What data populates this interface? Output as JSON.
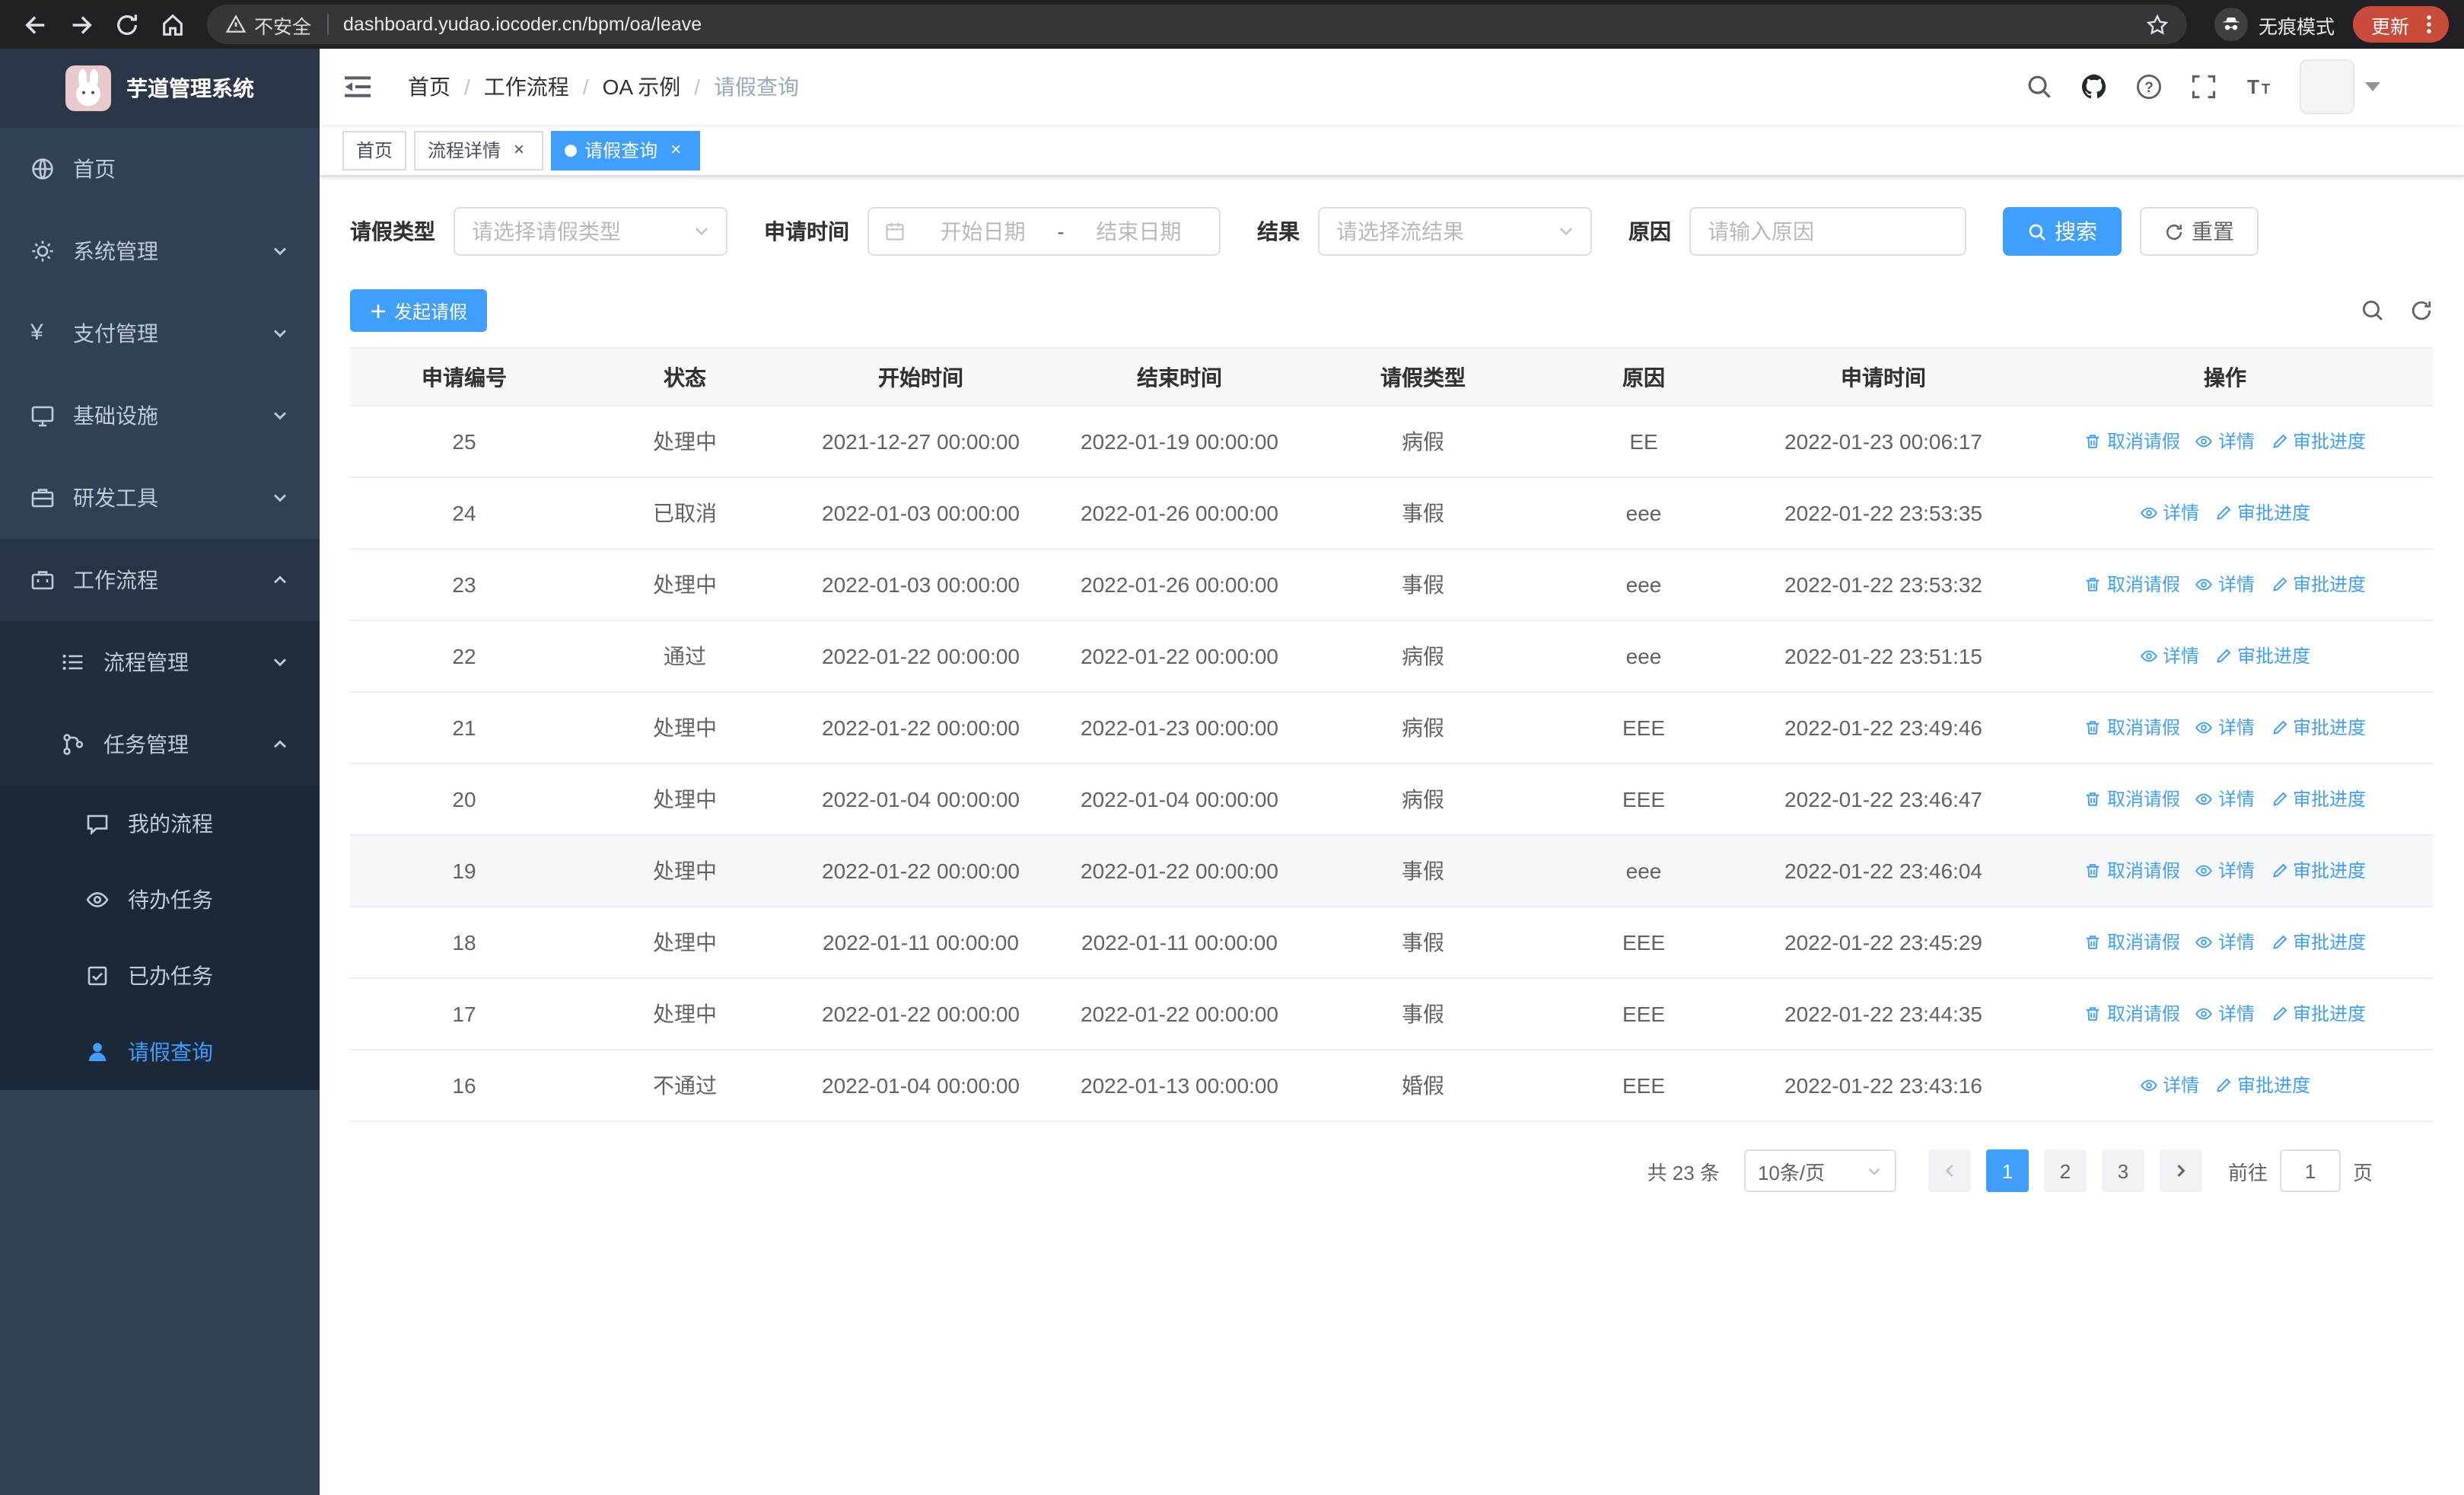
{
  "theme": {
    "primary": "#409eff",
    "sidebar_bg": "#304156",
    "sidebar_sub_bg": "#1f2d3d"
  },
  "browser": {
    "security_label": "不安全",
    "url": "dashboard.yudao.iocoder.cn/bpm/oa/leave",
    "incognito_label": "无痕模式",
    "update_label": "更新"
  },
  "sidebar": {
    "logo_title": "芋道管理系统",
    "menu": {
      "home": "首页",
      "system": "系统管理",
      "payment": "支付管理",
      "infra": "基础设施",
      "devtools": "研发工具",
      "workflow": "工作流程",
      "process_mgmt": "流程管理",
      "task_mgmt": "任务管理",
      "my_process": "我的流程",
      "todo_task": "待办任务",
      "done_task": "已办任务",
      "leave_query": "请假查询"
    }
  },
  "navbar": {
    "breadcrumb": [
      "首页",
      "工作流程",
      "OA 示例",
      "请假查询"
    ]
  },
  "tabs": [
    {
      "label": "首页",
      "closable": false,
      "active": false
    },
    {
      "label": "流程详情",
      "closable": true,
      "active": false
    },
    {
      "label": "请假查询",
      "closable": true,
      "active": true
    }
  ],
  "filters": {
    "leave_type_label": "请假类型",
    "leave_type_placeholder": "请选择请假类型",
    "apply_time_label": "申请时间",
    "date_start_placeholder": "开始日期",
    "date_separator": "-",
    "date_end_placeholder": "结束日期",
    "result_label": "结果",
    "result_placeholder": "请选择流结果",
    "reason_label": "原因",
    "reason_placeholder": "请输入原因",
    "search_label": "搜索",
    "reset_label": "重置"
  },
  "toolbar": {
    "create_label": "发起请假"
  },
  "table": {
    "columns": [
      "申请编号",
      "状态",
      "开始时间",
      "结束时间",
      "请假类型",
      "原因",
      "申请时间",
      "操作"
    ],
    "actions": {
      "cancel": "取消请假",
      "detail": "详情",
      "progress": "审批进度"
    },
    "rows": [
      {
        "id": "25",
        "status": "处理中",
        "start": "2021-12-27 00:00:00",
        "end": "2022-01-19 00:00:00",
        "type": "病假",
        "reason": "EE",
        "apply_time": "2022-01-23 00:06:17",
        "cancellable": true,
        "hover": false
      },
      {
        "id": "24",
        "status": "已取消",
        "start": "2022-01-03 00:00:00",
        "end": "2022-01-26 00:00:00",
        "type": "事假",
        "reason": "eee",
        "apply_time": "2022-01-22 23:53:35",
        "cancellable": false,
        "hover": false
      },
      {
        "id": "23",
        "status": "处理中",
        "start": "2022-01-03 00:00:00",
        "end": "2022-01-26 00:00:00",
        "type": "事假",
        "reason": "eee",
        "apply_time": "2022-01-22 23:53:32",
        "cancellable": true,
        "hover": false
      },
      {
        "id": "22",
        "status": "通过",
        "start": "2022-01-22 00:00:00",
        "end": "2022-01-22 00:00:00",
        "type": "病假",
        "reason": "eee",
        "apply_time": "2022-01-22 23:51:15",
        "cancellable": false,
        "hover": false
      },
      {
        "id": "21",
        "status": "处理中",
        "start": "2022-01-22 00:00:00",
        "end": "2022-01-23 00:00:00",
        "type": "病假",
        "reason": "EEE",
        "apply_time": "2022-01-22 23:49:46",
        "cancellable": true,
        "hover": false
      },
      {
        "id": "20",
        "status": "处理中",
        "start": "2022-01-04 00:00:00",
        "end": "2022-01-04 00:00:00",
        "type": "病假",
        "reason": "EEE",
        "apply_time": "2022-01-22 23:46:47",
        "cancellable": true,
        "hover": false
      },
      {
        "id": "19",
        "status": "处理中",
        "start": "2022-01-22 00:00:00",
        "end": "2022-01-22 00:00:00",
        "type": "事假",
        "reason": "eee",
        "apply_time": "2022-01-22 23:46:04",
        "cancellable": true,
        "hover": true
      },
      {
        "id": "18",
        "status": "处理中",
        "start": "2022-01-11 00:00:00",
        "end": "2022-01-11 00:00:00",
        "type": "事假",
        "reason": "EEE",
        "apply_time": "2022-01-22 23:45:29",
        "cancellable": true,
        "hover": false
      },
      {
        "id": "17",
        "status": "处理中",
        "start": "2022-01-22 00:00:00",
        "end": "2022-01-22 00:00:00",
        "type": "事假",
        "reason": "EEE",
        "apply_time": "2022-01-22 23:44:35",
        "cancellable": true,
        "hover": false
      },
      {
        "id": "16",
        "status": "不通过",
        "start": "2022-01-04 00:00:00",
        "end": "2022-01-13 00:00:00",
        "type": "婚假",
        "reason": "EEE",
        "apply_time": "2022-01-22 23:43:16",
        "cancellable": false,
        "hover": false
      }
    ]
  },
  "pagination": {
    "total_label": "共 23 条",
    "page_size_label": "10条/页",
    "pages": [
      "1",
      "2",
      "3"
    ],
    "active_page": "1",
    "goto_prefix": "前往",
    "goto_value": "1",
    "goto_suffix": "页"
  }
}
